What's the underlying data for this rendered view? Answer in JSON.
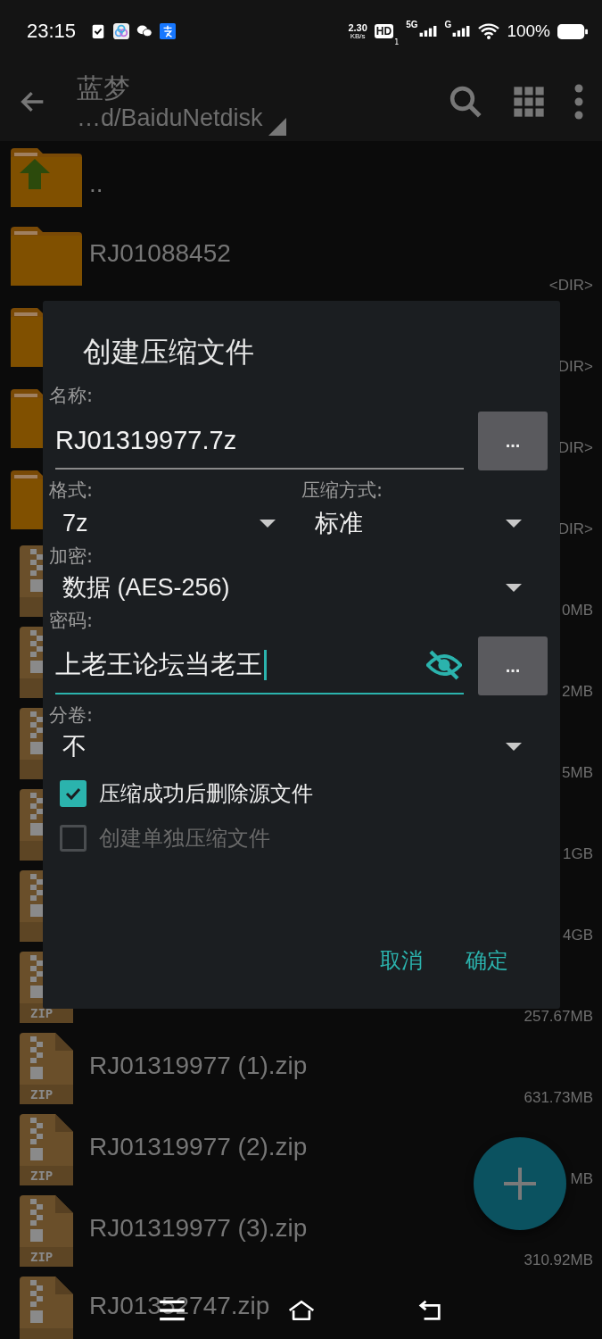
{
  "status_bar": {
    "time": "23:15",
    "net_speed": "2.30",
    "net_unit": "KB/s",
    "hd": "HD",
    "hd_sim": "1",
    "signal_1": "5G",
    "signal_2": "G",
    "battery": "100%"
  },
  "toolbar": {
    "title": "蓝梦",
    "path": "…d/BaiduNetdisk"
  },
  "files": [
    {
      "kind": "up",
      "name": ".."
    },
    {
      "kind": "folder",
      "name": "RJ01088452",
      "size": "<DIR>"
    },
    {
      "kind": "folder",
      "size": "DIR>"
    },
    {
      "kind": "folder",
      "size": "DIR>"
    },
    {
      "kind": "folder",
      "size": "DIR>"
    },
    {
      "kind": "zip",
      "size": "0MB"
    },
    {
      "kind": "zip",
      "size": "2MB"
    },
    {
      "kind": "zip",
      "size": "5MB"
    },
    {
      "kind": "zip",
      "size": "1GB"
    },
    {
      "kind": "zip",
      "size": "4GB"
    },
    {
      "kind": "zip",
      "icon_label": "ZIP",
      "size": "257.67MB"
    },
    {
      "kind": "zip",
      "icon_label": "ZIP",
      "name": "RJ01319977 (1).zip",
      "size": "631.73MB"
    },
    {
      "kind": "zip",
      "icon_label": "ZIP",
      "name": "RJ01319977 (2).zip",
      "size": "MB"
    },
    {
      "kind": "zip",
      "icon_label": "ZIP",
      "name": "RJ01319977 (3).zip",
      "size": "310.92MB"
    },
    {
      "kind": "zip",
      "name": "RJ01352747.zip"
    }
  ],
  "dialog": {
    "title": "创建压缩文件",
    "name_label": "名称:",
    "name_value": "RJ01319977.7z",
    "browse_button": "...",
    "format_label": "格式:",
    "format_value": "7z",
    "method_label": "压缩方式:",
    "method_value": "标准",
    "encryption_label": "加密:",
    "encryption_value": "数据 (AES-256)",
    "password_label": "密码:",
    "password_value": "上老王论坛当老王",
    "password_browse_button": "...",
    "split_label": "分卷:",
    "split_value": "不",
    "checkboxes": [
      {
        "label": "压缩成功后删除源文件",
        "checked": true,
        "disabled": false
      },
      {
        "label": "创建单独压缩文件",
        "checked": false,
        "disabled": true
      }
    ],
    "buttons": [
      "取消",
      "确定"
    ]
  }
}
